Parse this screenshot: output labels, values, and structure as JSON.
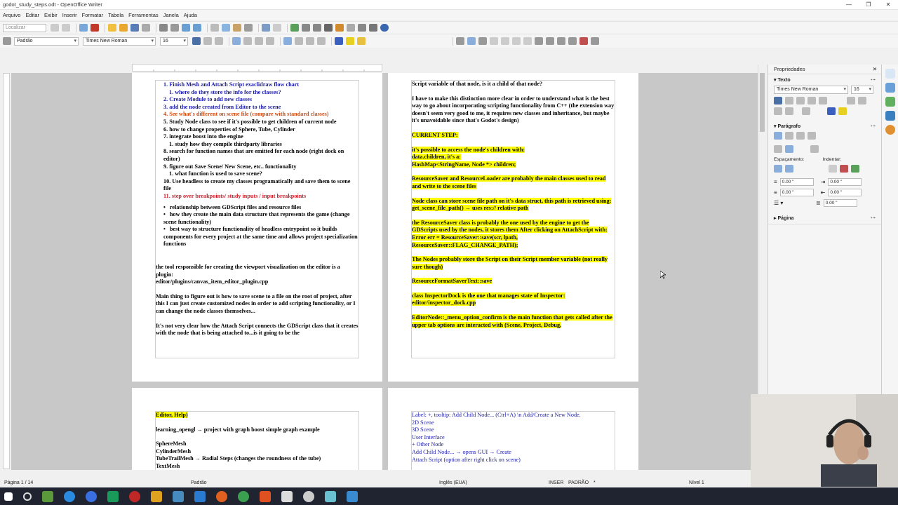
{
  "window": {
    "title": "godot_study_steps.odt - OpenOffice Writer",
    "controls": [
      "—",
      "❐",
      "✕"
    ]
  },
  "menu": [
    "Arquivo",
    "Editar",
    "Exibir",
    "Inserir",
    "Formatar",
    "Tabela",
    "Ferramentas",
    "Janela",
    "Ajuda"
  ],
  "toolbar": {
    "find_placeholder": "Localizar",
    "paragraph_style": "Padrão",
    "font_name": "Times New Roman",
    "font_size": "16"
  },
  "page1_left": {
    "items": [
      {
        "num": "1.",
        "text": "Finish Mesh and Attach Script exaclidraw flow chart",
        "color": "blue"
      },
      {
        "num": "1.",
        "text": "where do they store the info for the classes?",
        "color": "blue",
        "indent": true
      },
      {
        "num": "2.",
        "text": "Create Module to add new classes",
        "color": "blue"
      },
      {
        "num": "3.",
        "text": "add the node created from Editor to the scene",
        "color": "blue"
      },
      {
        "num": "4.",
        "text": "See what's different on scene file (compare with standard classes)",
        "color": "orange"
      },
      {
        "num": "5.",
        "text": "Study Node class to see if it's possible to get children of current node",
        "color": "black"
      },
      {
        "num": "6.",
        "text": "how to change properties of Sphere, Tube, Cylinder",
        "color": "black"
      },
      {
        "num": "7.",
        "text": "integrate boost into the engine",
        "color": "black"
      },
      {
        "num": "1.",
        "text": "study how they compile thirdparty libraries",
        "color": "black",
        "indent": true
      },
      {
        "num": "8.",
        "text": "search for function names that are emitted for each node (right dock on editor)",
        "color": "black"
      },
      {
        "num": "9.",
        "text": "figure out Save Scene/ New Scene, etc.. functionality",
        "color": "black"
      },
      {
        "num": "1.",
        "text": "what function is used to save scene?",
        "color": "black",
        "indent": true
      },
      {
        "num": "10.",
        "text": "Use headless to create my classes programatically and save them to scene file",
        "color": "black"
      },
      {
        "num": "11.",
        "text": "step over breakpoints/ study inputs / input breakpoints",
        "color": "red"
      }
    ],
    "bullets": [
      "relationship between GDScript files and resource files",
      "how they create the main data structure that represents the game (change scene functionality)",
      "best way to structure functionality of headless entrypoint so it builds components for every project at the same time and allows project specialization functions"
    ],
    "para1": "the tool responsible for creating the viewport visualization on the editor is a plugin:",
    "para1b": "editor/plugins/canvas_item_editor_plugin.cpp",
    "para2": "Main thing to figure out is how to save scene to a file on the root of project, after this I can just create customized nodes in order to add scripting functionality, or I can change the node classes themselves...",
    "para3": "It's not very clear how the Attach Script connects the GDScript class that it creates with the node that is being attached to...is it going to be the"
  },
  "page1_right": {
    "p1": "Script variable of that node, is it a child of that node?",
    "p2": "I have to make this distinction more clear in order to understand what is the best way to go about incorporating scripting functionality from C++ (the extension way doesn't seem very good to me, it requires new classes and inheritance, but maybe it's unavoidable since that's Godot's design)",
    "current_step": "CURRENT STEP:",
    "h1": "it's possible to access the node's children with:",
    "h1b": "data.children, it's a:",
    "h1c": "HashMap<StringName, Node *> children;",
    "h2": "ResourceSaver and ResourceLoader are probably the main classes used to read and write to the scene files",
    "h3": "Node class can store scene file path on it's data struct, this path is retrieved using:",
    "h3b": "get_scene_file_path() → uses res:// relative path",
    "h4": "the ResourceSaver class is probably the one used by the engine to get the GDScripts used by the nodes, it stores them After clicking on AttachScript with:",
    "h4b": "Error err = ResourceSaver::save(scr, lpath, ResourceSaver::FLAG_CHANGE_PATH);",
    "h5": "The Nodes probably store the Script on their Script member variable (not really sure though)",
    "h6": "ResourceFormatSaverText::save",
    "h7": "class InspectorDock is the one that manages state of Inspector: editor/inspector_dock.cpp",
    "h8": "EditorNode::_menu_option_confirm is the main function that gets called after the upper tab options are interacted with (Scene, Project, Debug,"
  },
  "page2_left": {
    "l1": "Editor, Help)",
    "l2": "learning_opengl → project with graph boost simple graph example",
    "l3": "SphereMesh",
    "l4": "CylinderMesh",
    "l5": "TubeTrailMesh → Radial Steps (changes the roundness of the tube)",
    "l6": "TextMesh"
  },
  "page2_right": {
    "lines": [
      "Label: +, tooltip: Add Child Node... (Ctrl+A) \\n Add/Create a New Node.",
      "2D Scene",
      "3D Scene",
      "User Interface",
      "+ Other Node",
      "Add Child Node... → opens GUI → Create",
      "Attach Script (option after right click on scene)"
    ]
  },
  "properties": {
    "title": "Propriedades",
    "text_section": "Texto",
    "font_name": "Times New Roman",
    "font_size": "16",
    "paragraph_section": "Parágrafo",
    "spacing_label": "Espaçamento:",
    "indent_label": "Indentar:",
    "spin_values": [
      "0.00 \"",
      "0.00 \"",
      "0.00 \"",
      "0.00 \"",
      "0.00 \""
    ],
    "page_section": "Página"
  },
  "status": {
    "page": "Página 1 / 14",
    "style": "Padrão",
    "language": "Inglês (EUA)",
    "mode": "INSER",
    "selection": "PADRÃO",
    "modified": "*",
    "level": "Nível 1"
  },
  "colors": {
    "highlight": "#ffff00",
    "link_blue": "#1a1aa8",
    "red_text": "#d0202a",
    "orange_text": "#d04a10",
    "taskbar": "#1f2430"
  }
}
